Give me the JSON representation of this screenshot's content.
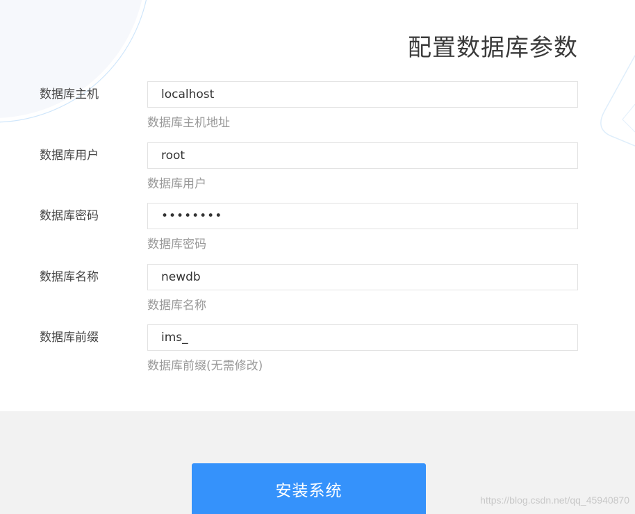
{
  "page": {
    "title": "配置数据库参数"
  },
  "form": {
    "fields": [
      {
        "label": "数据库主机",
        "value": "localhost",
        "hint": "数据库主机地址",
        "type": "text"
      },
      {
        "label": "数据库用户",
        "value": "root",
        "hint": "数据库用户",
        "type": "text"
      },
      {
        "label": "数据库密码",
        "value": "12345678",
        "hint": "数据库密码",
        "type": "password"
      },
      {
        "label": "数据库名称",
        "value": "newdb",
        "hint": "数据库名称",
        "type": "text"
      },
      {
        "label": "数据库前缀",
        "value": "ims_",
        "hint": "数据库前缀(无需修改)",
        "type": "text"
      }
    ]
  },
  "footer": {
    "install_label": "安装系统"
  },
  "watermark": {
    "text": "https://blog.csdn.net/qq_45940870"
  },
  "colors": {
    "accent": "#3592fb",
    "hint": "#999999",
    "footer_bg": "#f2f2f2"
  }
}
